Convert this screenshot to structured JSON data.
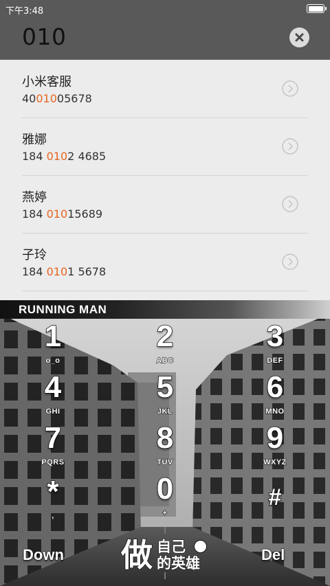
{
  "status_bar": {
    "time": "下午3:48",
    "battery_level": 1.0
  },
  "search": {
    "value": "010",
    "clear_icon": "close-icon"
  },
  "results": [
    {
      "name": "小米客服",
      "number_pre": "40",
      "number_match": "010",
      "number_post": "05678"
    },
    {
      "name": "雅娜",
      "number_pre": "184 ",
      "number_match": "010",
      "number_post": "2 4685"
    },
    {
      "name": "燕婷",
      "number_pre": "184 ",
      "number_match": "010",
      "number_post": "15689"
    },
    {
      "name": "子玲",
      "number_pre": "184 ",
      "number_match": "010",
      "number_post": "1 5678"
    }
  ],
  "theme": {
    "banner": "RUNNING MAN",
    "highlight_color": "#e8651f"
  },
  "keypad": [
    {
      "digit": "1",
      "letters": "o_o"
    },
    {
      "digit": "2",
      "letters": "ABC"
    },
    {
      "digit": "3",
      "letters": "DEF"
    },
    {
      "digit": "4",
      "letters": "GHI"
    },
    {
      "digit": "5",
      "letters": "JKL"
    },
    {
      "digit": "6",
      "letters": "MNO"
    },
    {
      "digit": "7",
      "letters": "PQRS"
    },
    {
      "digit": "8",
      "letters": "TUV"
    },
    {
      "digit": "9",
      "letters": "WXYZ"
    },
    {
      "digit": "*",
      "letters": ","
    },
    {
      "digit": "0",
      "letters": "+"
    },
    {
      "digit": "#",
      "letters": ""
    }
  ],
  "bottom": {
    "left_label": "Down",
    "right_label": "Del",
    "logo_big": "做",
    "logo_top": "自己",
    "logo_bottom": "的英雄"
  }
}
